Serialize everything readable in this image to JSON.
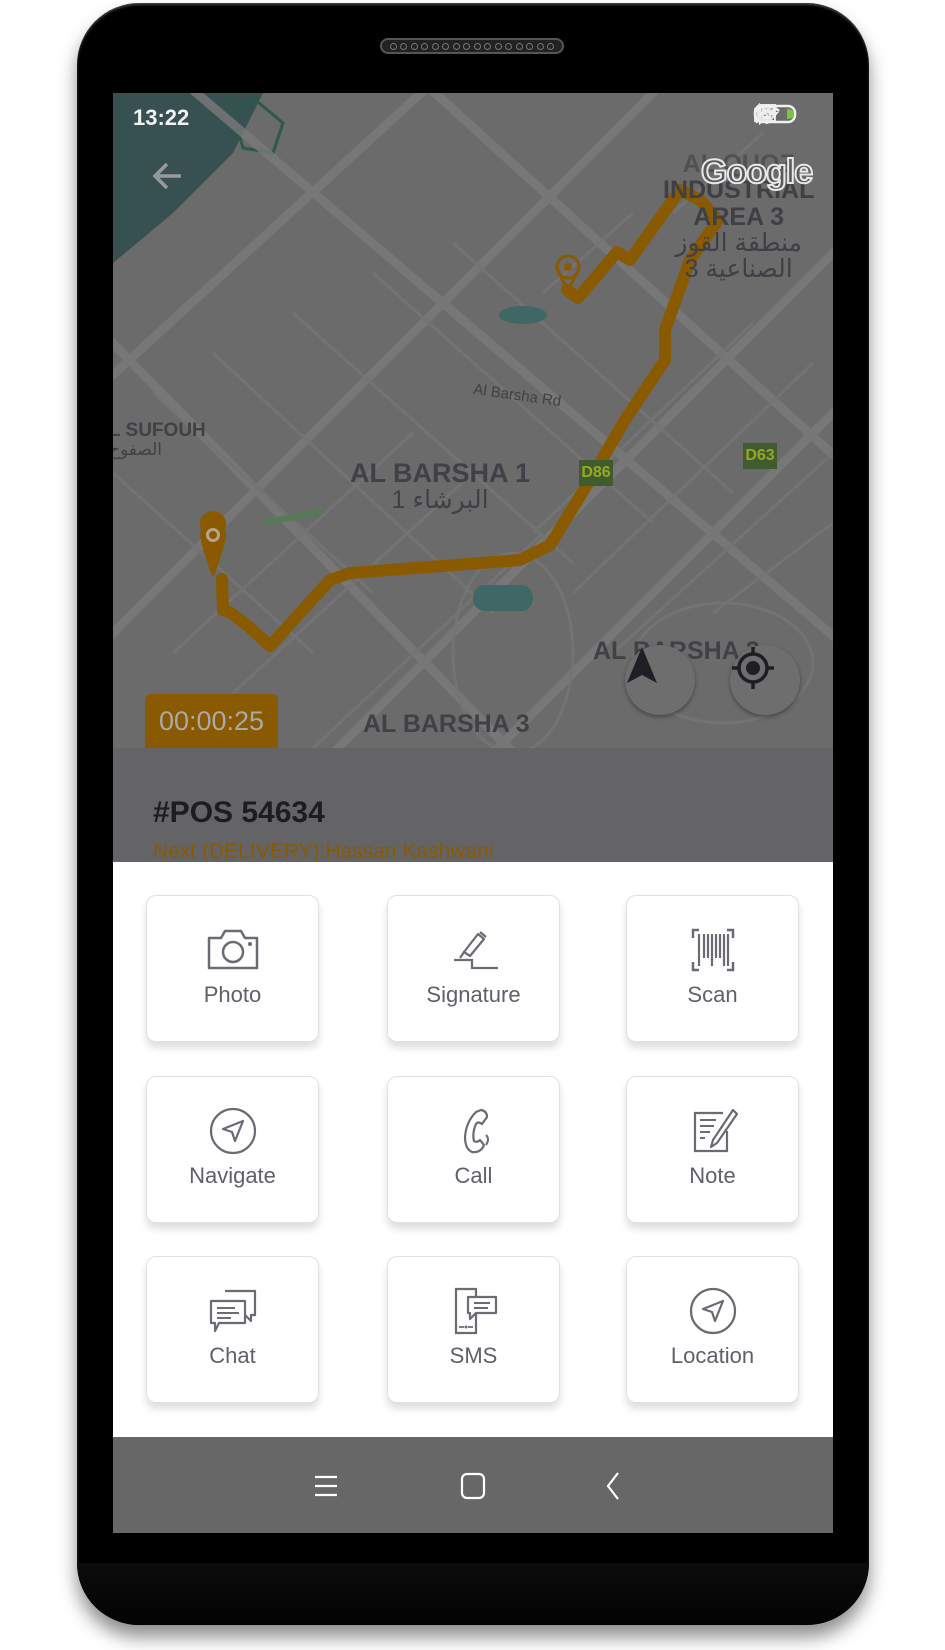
{
  "status_bar": {
    "time": "13:22",
    "icons": [
      "hotspot-icon",
      "bluetooth-icon",
      "muted-bell-icon",
      "no-sim-icon",
      "wifi-icon",
      "battery-charging-icon"
    ]
  },
  "map": {
    "back_icon": "arrow-left-icon",
    "attribution": "Google",
    "labels": {
      "quoz": "AL QUOZ INDUSTRIAL AREA 3",
      "quoz_line1": "AL QUOZ",
      "quoz_line2": "INDUSTRIAL",
      "quoz_line3": "AREA 3",
      "quoz_ar1": "منطقة القوز",
      "quoz_ar2": "الصناعية 3",
      "al_barsha_rd": "Al Barsha Rd",
      "sufouh": "L SUFOUH",
      "sufouh_ar": "الصفوح",
      "barsha1": "AL BARSHA 1",
      "barsha1_ar": "البرشاء 1",
      "barsha2": "AL BARSHA 2",
      "barsha3": "AL BARSHA 3"
    },
    "road_badges": [
      "D86",
      "D63"
    ],
    "route_color": "#8a5a00",
    "timer": "00:00:25",
    "compass_icon": "navigation-arrow-icon",
    "locate_icon": "my-location-icon"
  },
  "order": {
    "id": "#POS 54634",
    "next_label": "Next (DELIVERY):Hassan Kashwani"
  },
  "actions": [
    {
      "label": "Photo",
      "icon": "camera-icon"
    },
    {
      "label": "Signature",
      "icon": "signature-pen-icon"
    },
    {
      "label": "Scan",
      "icon": "barcode-scan-icon"
    },
    {
      "label": "Navigate",
      "icon": "navigate-arrow-icon"
    },
    {
      "label": "Call",
      "icon": "phone-icon"
    },
    {
      "label": "Note",
      "icon": "note-edit-icon"
    },
    {
      "label": "Chat",
      "icon": "chat-bubbles-icon"
    },
    {
      "label": "SMS",
      "icon": "sms-phone-icon"
    },
    {
      "label": "Location",
      "icon": "location-arrow-icon"
    }
  ],
  "nav_bar": {
    "recents_icon": "menu-lines-icon",
    "home_icon": "home-square-icon",
    "back_icon": "back-chevron-icon"
  }
}
